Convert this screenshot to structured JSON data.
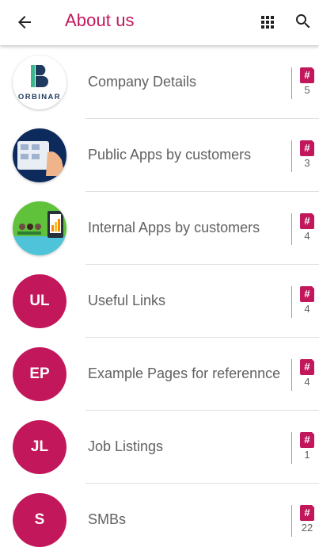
{
  "header": {
    "title": "About us",
    "back_icon": "arrow-left-icon",
    "grid_icon": "apps-grid-icon",
    "search_icon": "search-icon"
  },
  "colors": {
    "accent": "#c2185b",
    "text": "#616161",
    "divider": "#e0e0e0"
  },
  "items": [
    {
      "label": "Company Details",
      "count": "5",
      "avatar_type": "image",
      "avatar_text": "ORBINAR",
      "avatar_icon": "company-logo-icon"
    },
    {
      "label": "Public Apps by customers",
      "count": "3",
      "avatar_type": "image",
      "avatar_icon": "phone-apps-icon"
    },
    {
      "label": "Internal Apps by customers",
      "count": "4",
      "avatar_type": "image",
      "avatar_icon": "office-apps-icon"
    },
    {
      "label": "Useful Links",
      "count": "4",
      "avatar_type": "initials",
      "initials": "UL"
    },
    {
      "label": "Example Pages for referennce",
      "count": "4",
      "avatar_type": "initials",
      "initials": "EP"
    },
    {
      "label": "Job Listings",
      "count": "1",
      "avatar_type": "initials",
      "initials": "JL"
    },
    {
      "label": "SMBs",
      "count": "22",
      "avatar_type": "initials",
      "initials": "S"
    }
  ],
  "badge_symbol": "#"
}
